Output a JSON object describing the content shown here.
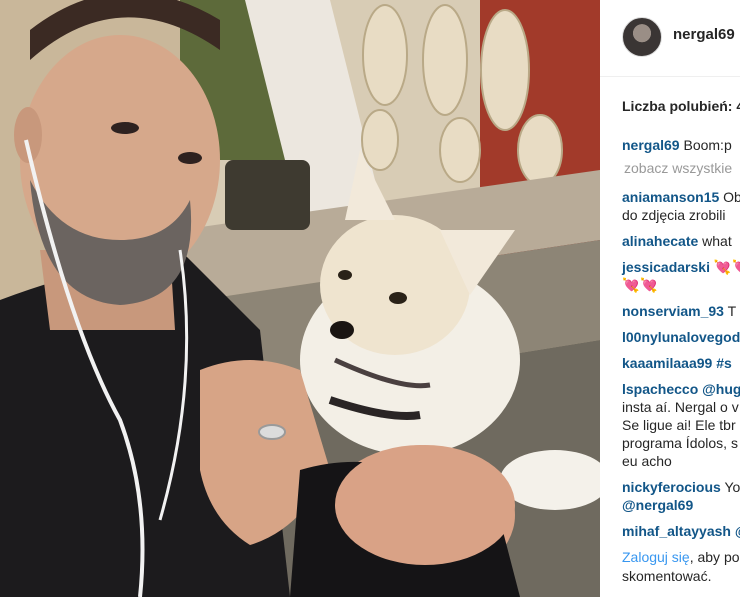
{
  "post": {
    "photo_alt": "photo",
    "username": "nergal69",
    "likes_label": "Liczba polubień: 4"
  },
  "caption": {
    "user": "nergal69",
    "text": "Boom:p"
  },
  "view_all": "zobacz wszystkie",
  "comments": [
    {
      "user": "aniamanson15",
      "lines": [
        "Ob",
        "do zdjęcia zrobili"
      ]
    },
    {
      "user": "alinahecate",
      "lines": [
        "what"
      ]
    },
    {
      "user": "jessicadarski",
      "lines": [
        "💘💘",
        "💘💘"
      ]
    },
    {
      "user": "nonserviam_93",
      "lines": [
        "T"
      ]
    },
    {
      "user": "l00nylunalovegod",
      "lines": [
        ""
      ]
    },
    {
      "user": "kaaamilaaa99",
      "lines": [
        "#s"
      ]
    },
    {
      "user": "lspachecco",
      "lines": [
        "@hug",
        "insta aí. Nergal o v",
        "Se ligue ai! Ele tbr",
        "programa Ídolos, s",
        "eu acho"
      ]
    },
    {
      "user": "nickyferocious",
      "lines": [
        "Yo",
        "@nergal69"
      ]
    },
    {
      "user": "mihaf_altayyash",
      "lines": [
        "@"
      ]
    }
  ],
  "login": {
    "link": "Zaloguj się",
    "text": ", aby po",
    "text2": "skomentować."
  },
  "colors": {
    "username": "#125688",
    "link": "#3897f0",
    "muted": "#999999"
  }
}
